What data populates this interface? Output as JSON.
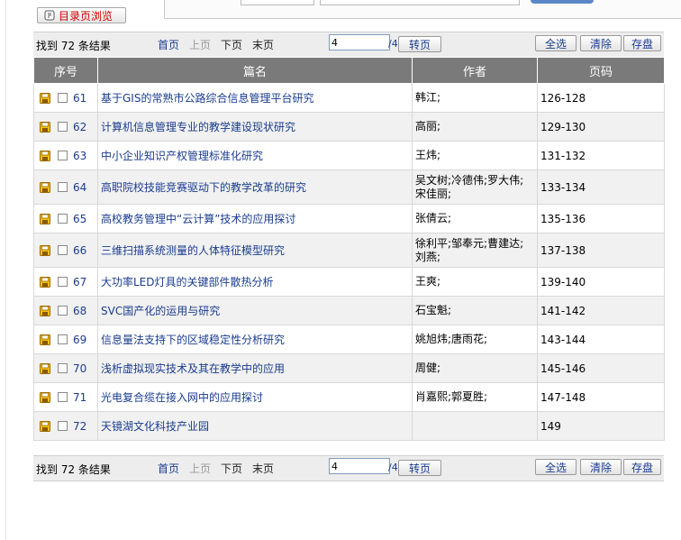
{
  "header": {
    "catalog_button": "目录页浏览"
  },
  "pagination": {
    "found_text": "找到 72 条结果",
    "first": "首页",
    "prev": "上页",
    "next": "下页",
    "last": "末页",
    "current_page": "4",
    "total_pages": "/4",
    "go": "转页",
    "select_all": "全选",
    "clear": "清除",
    "save": "存盘"
  },
  "table": {
    "headers": [
      "序号",
      "篇名",
      "作者",
      "页码"
    ],
    "rows": [
      {
        "num": "61",
        "title": "基于GIS的常熟市公路综合信息管理平台研究",
        "author": "韩江;",
        "pages": "126-128"
      },
      {
        "num": "62",
        "title": "计算机信息管理专业的教学建设现状研究",
        "author": "高丽;",
        "pages": "129-130"
      },
      {
        "num": "63",
        "title": "中小企业知识产权管理标准化研究",
        "author": "王炜;",
        "pages": "131-132"
      },
      {
        "num": "64",
        "title": "高职院校技能竞赛驱动下的教学改革的研究",
        "author": "吴文树;冷德伟;罗大伟;宋佳丽;",
        "pages": "133-134"
      },
      {
        "num": "65",
        "title": "高校教务管理中“云计算”技术的应用探讨",
        "author": "张倩云;",
        "pages": "135-136"
      },
      {
        "num": "66",
        "title": "三维扫描系统测量的人体特征模型研究",
        "author": "徐利平;邹奉元;曹建达;刘燕;",
        "pages": "137-138"
      },
      {
        "num": "67",
        "title": "大功率LED灯具的关键部件散热分析",
        "author": "王爽;",
        "pages": "139-140"
      },
      {
        "num": "68",
        "title": "SVC国产化的运用与研究",
        "author": "石宝魁;",
        "pages": "141-142"
      },
      {
        "num": "69",
        "title": "信息量法支持下的区域稳定性分析研究",
        "author": "姚旭炜;唐雨花;",
        "pages": "143-144"
      },
      {
        "num": "70",
        "title": "浅析虚拟现实技术及其在教学中的应用",
        "author": "周健;",
        "pages": "145-146"
      },
      {
        "num": "71",
        "title": "光电复合缆在接入网中的应用探讨",
        "author": "肖嘉熙;郭夏胜;",
        "pages": "147-148"
      },
      {
        "num": "72",
        "title": "天镜湖文化科技产业园",
        "author": "",
        "pages": "149"
      }
    ]
  },
  "colors": {
    "link": "#1a3c8f",
    "header_bg": "#7a7a7a",
    "catalog_text": "#cc0000"
  }
}
